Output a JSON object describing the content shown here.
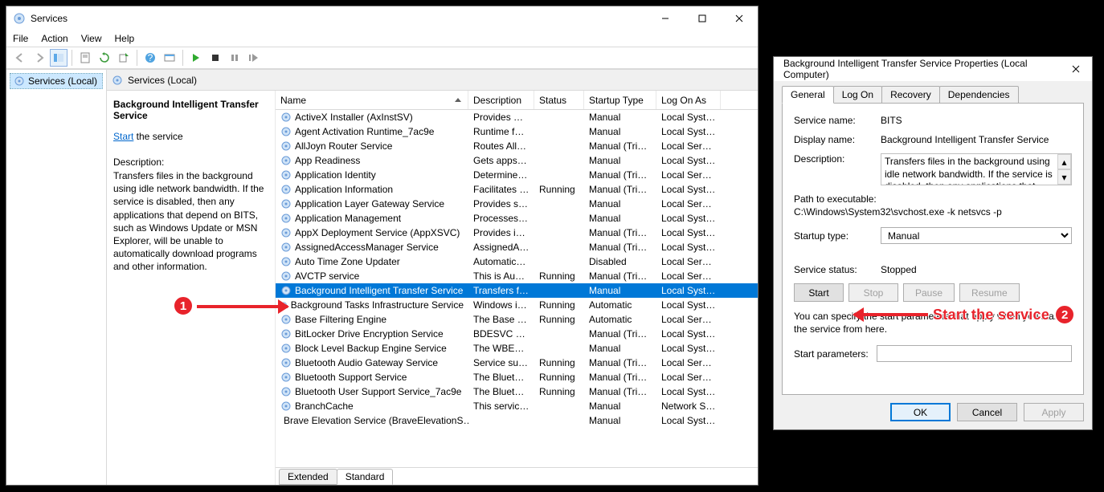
{
  "window": {
    "title": "Services",
    "menu": [
      "File",
      "Action",
      "View",
      "Help"
    ],
    "tree_label": "Services (Local)",
    "header_label": "Services (Local)",
    "tabs": [
      "Extended",
      "Standard"
    ],
    "active_tab": 1
  },
  "detail": {
    "title": "Background Intelligent Transfer Service",
    "start_link": "Start",
    "start_suffix": " the service",
    "desc_label": "Description:",
    "desc": "Transfers files in the background using idle network bandwidth. If the service is disabled, then any applications that depend on BITS, such as Windows Update or MSN Explorer, will be unable to automatically download programs and other information."
  },
  "columns": [
    "Name",
    "Description",
    "Status",
    "Startup Type",
    "Log On As"
  ],
  "rows": [
    {
      "n": "ActiveX Installer (AxInstSV)",
      "d": "Provides Us…",
      "s": "",
      "t": "Manual",
      "l": "Local Syste…"
    },
    {
      "n": "Agent Activation Runtime_7ac9e",
      "d": "Runtime for…",
      "s": "",
      "t": "Manual",
      "l": "Local Syste…"
    },
    {
      "n": "AllJoyn Router Service",
      "d": "Routes AllJo…",
      "s": "",
      "t": "Manual (Trig…",
      "l": "Local Service"
    },
    {
      "n": "App Readiness",
      "d": "Gets apps re…",
      "s": "",
      "t": "Manual",
      "l": "Local Syste…"
    },
    {
      "n": "Application Identity",
      "d": "Determines …",
      "s": "",
      "t": "Manual (Trig…",
      "l": "Local Service"
    },
    {
      "n": "Application Information",
      "d": "Facilitates t…",
      "s": "Running",
      "t": "Manual (Trig…",
      "l": "Local Syste…"
    },
    {
      "n": "Application Layer Gateway Service",
      "d": "Provides su…",
      "s": "",
      "t": "Manual",
      "l": "Local Service"
    },
    {
      "n": "Application Management",
      "d": "Processes in…",
      "s": "",
      "t": "Manual",
      "l": "Local Syste…"
    },
    {
      "n": "AppX Deployment Service (AppXSVC)",
      "d": "Provides inf…",
      "s": "",
      "t": "Manual (Trig…",
      "l": "Local Syste…"
    },
    {
      "n": "AssignedAccessManager Service",
      "d": "AssignedAc…",
      "s": "",
      "t": "Manual (Trig…",
      "l": "Local Syste…"
    },
    {
      "n": "Auto Time Zone Updater",
      "d": "Automatica…",
      "s": "",
      "t": "Disabled",
      "l": "Local Service"
    },
    {
      "n": "AVCTP service",
      "d": "This is Audi…",
      "s": "Running",
      "t": "Manual (Trig…",
      "l": "Local Service"
    },
    {
      "n": "Background Intelligent Transfer Service",
      "d": "Transfers fil…",
      "s": "",
      "t": "Manual",
      "l": "Local Syste…",
      "sel": true
    },
    {
      "n": "Background Tasks Infrastructure Service",
      "d": "Windows in…",
      "s": "Running",
      "t": "Automatic",
      "l": "Local Syste…"
    },
    {
      "n": "Base Filtering Engine",
      "d": "The Base Fil…",
      "s": "Running",
      "t": "Automatic",
      "l": "Local Service"
    },
    {
      "n": "BitLocker Drive Encryption Service",
      "d": "BDESVC hos…",
      "s": "",
      "t": "Manual (Trig…",
      "l": "Local Syste…"
    },
    {
      "n": "Block Level Backup Engine Service",
      "d": "The WBENG…",
      "s": "",
      "t": "Manual",
      "l": "Local Syste…"
    },
    {
      "n": "Bluetooth Audio Gateway Service",
      "d": "Service sup…",
      "s": "Running",
      "t": "Manual (Trig…",
      "l": "Local Service"
    },
    {
      "n": "Bluetooth Support Service",
      "d": "The Bluetoo…",
      "s": "Running",
      "t": "Manual (Trig…",
      "l": "Local Service"
    },
    {
      "n": "Bluetooth User Support Service_7ac9e",
      "d": "The Bluetoo…",
      "s": "Running",
      "t": "Manual (Trig…",
      "l": "Local Syste…"
    },
    {
      "n": "BranchCache",
      "d": "This service …",
      "s": "",
      "t": "Manual",
      "l": "Network S…"
    },
    {
      "n": "Brave Elevation Service (BraveElevationS…",
      "d": "",
      "s": "",
      "t": "Manual",
      "l": "Local Syste…"
    }
  ],
  "dialog": {
    "title": "Background Intelligent Transfer Service Properties (Local Computer)",
    "tabs": [
      "General",
      "Log On",
      "Recovery",
      "Dependencies"
    ],
    "labels": {
      "service_name": "Service name:",
      "display_name": "Display name:",
      "description": "Description:",
      "path_label": "Path to executable:",
      "startup_type": "Startup type:",
      "service_status": "Service status:",
      "start_parameters": "Start parameters:"
    },
    "service_name": "BITS",
    "display_name": "Background Intelligent Transfer Service",
    "description": "Transfers files in the background using idle network bandwidth. If the service is disabled, then any applications that depend on BITS, such as Windows",
    "path": "C:\\Windows\\System32\\svchost.exe -k netsvcs -p",
    "startup_type": "Manual",
    "status": "Stopped",
    "buttons": {
      "start": "Start",
      "stop": "Stop",
      "pause": "Pause",
      "resume": "Resume"
    },
    "note": "You can specify the start parameters that apply when you start the service from here.",
    "start_parameters": "",
    "ok": "OK",
    "cancel": "Cancel",
    "apply": "Apply"
  },
  "annotation": {
    "label2": "Start the service"
  }
}
